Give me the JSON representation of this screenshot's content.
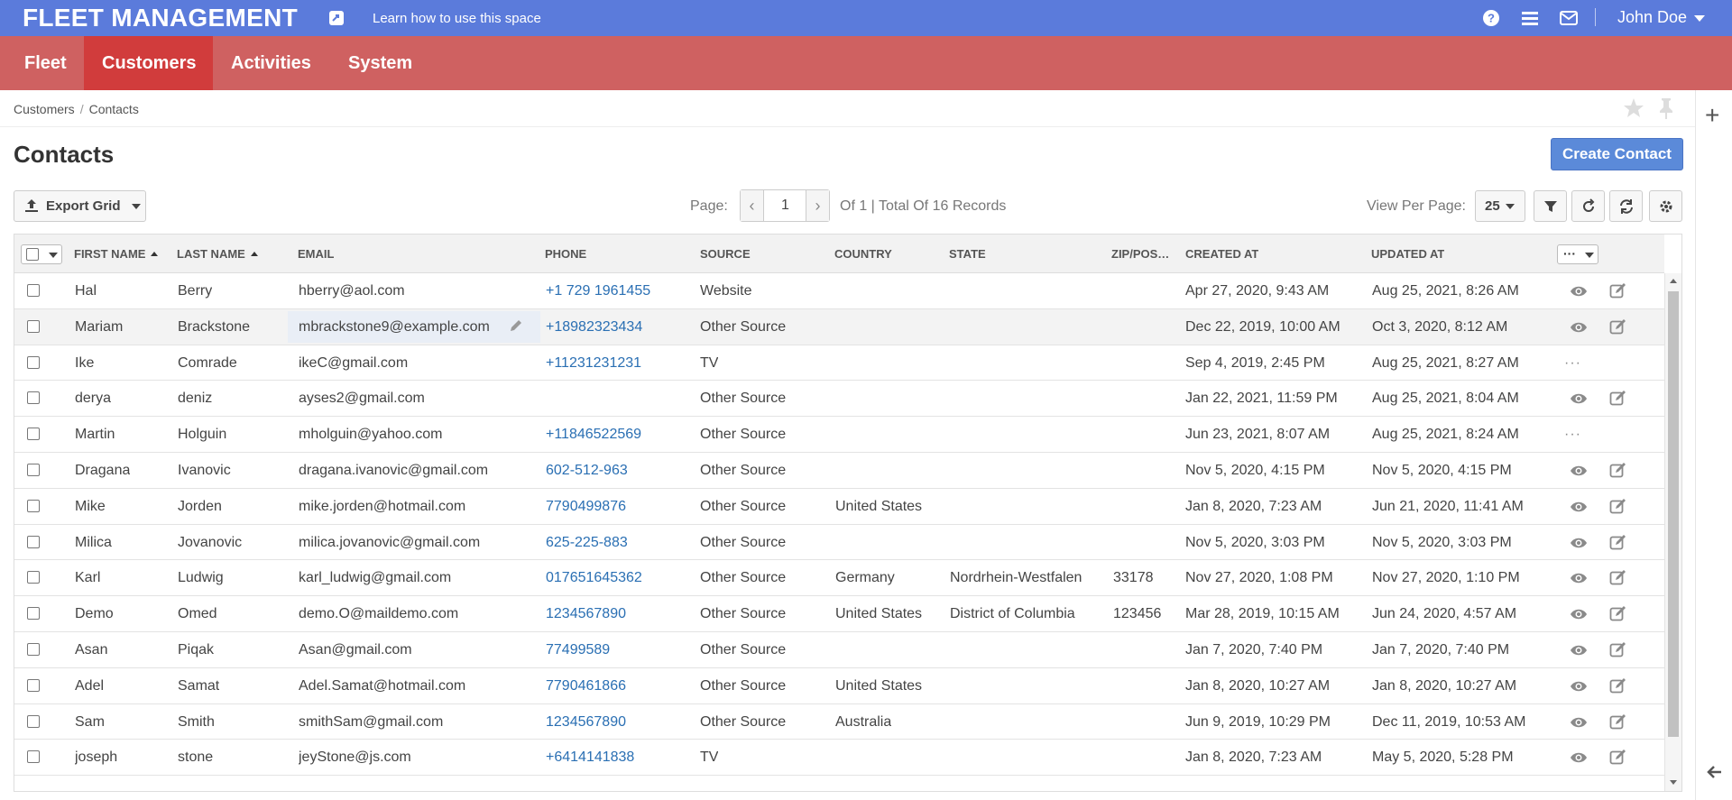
{
  "app": {
    "title": "FLEET MANAGEMENT",
    "learn_link": "Learn how to use this space",
    "user_name": "John Doe",
    "icons": [
      "help-icon",
      "list-icon",
      "mail-icon"
    ]
  },
  "nav": {
    "items": [
      {
        "label": "Fleet",
        "active": false
      },
      {
        "label": "Customers",
        "active": true
      },
      {
        "label": "Activities",
        "active": false
      },
      {
        "label": "System",
        "active": false
      }
    ]
  },
  "breadcrumb": {
    "parent": "Customers",
    "separator": "/",
    "current": "Contacts"
  },
  "page": {
    "title": "Contacts",
    "create_button": "Create Contact"
  },
  "toolbar": {
    "export_label": "Export Grid",
    "page_label": "Page:",
    "page_value": "1",
    "page_total": "Of 1 | Total Of 16 Records",
    "view_per_page_label": "View Per Page:",
    "view_per_page_value": "25"
  },
  "grid": {
    "columns": [
      "First Name",
      "Last Name",
      "Email",
      "Phone",
      "Source",
      "Country",
      "State",
      "Zip/Pos…",
      "Created At",
      "Updated At"
    ],
    "rows": [
      {
        "first": "Hal",
        "last": "Berry",
        "email": "hberry@aol.com",
        "phone": "+1 729 1961455",
        "source": "Website",
        "country": "",
        "state": "",
        "zip": "",
        "created": "Apr 27, 2020, 9:43 AM",
        "updated": "Aug 25, 2021, 8:26 AM",
        "actions": "icons"
      },
      {
        "first": "Mariam",
        "last": "Brackstone",
        "email": "mbrackstone9@example.com",
        "phone": "+18982323434",
        "source": "Other Source",
        "country": "",
        "state": "",
        "zip": "",
        "created": "Dec 22, 2019, 10:00 AM",
        "updated": "Oct 3, 2020, 8:12 AM",
        "actions": "icons"
      },
      {
        "first": "Ike",
        "last": "Comrade",
        "email": "ikeC@gmail.com",
        "phone": "+11231231231",
        "source": "TV",
        "country": "",
        "state": "",
        "zip": "",
        "created": "Sep 4, 2019, 2:45 PM",
        "updated": "Aug 25, 2021, 8:27 AM",
        "actions": "more"
      },
      {
        "first": "derya",
        "last": "deniz",
        "email": "ayses2@gmail.com",
        "phone": "",
        "source": "Other Source",
        "country": "",
        "state": "",
        "zip": "",
        "created": "Jan 22, 2021, 11:59 PM",
        "updated": "Aug 25, 2021, 8:04 AM",
        "actions": "icons"
      },
      {
        "first": "Martin",
        "last": "Holguin",
        "email": "mholguin@yahoo.com",
        "phone": "+11846522569",
        "source": "Other Source",
        "country": "",
        "state": "",
        "zip": "",
        "created": "Jun 23, 2021, 8:07 AM",
        "updated": "Aug 25, 2021, 8:24 AM",
        "actions": "more"
      },
      {
        "first": "Dragana",
        "last": "Ivanovic",
        "email": "dragana.ivanovic@gmail.com",
        "phone": "602-512-963",
        "source": "Other Source",
        "country": "",
        "state": "",
        "zip": "",
        "created": "Nov 5, 2020, 4:15 PM",
        "updated": "Nov 5, 2020, 4:15 PM",
        "actions": "icons"
      },
      {
        "first": "Mike",
        "last": "Jorden",
        "email": "mike.jorden@hotmail.com",
        "phone": "7790499876",
        "source": "Other Source",
        "country": "United States",
        "state": "",
        "zip": "",
        "created": "Jan 8, 2020, 7:23 AM",
        "updated": "Jun 21, 2020, 11:41 AM",
        "actions": "icons"
      },
      {
        "first": "Milica",
        "last": "Jovanovic",
        "email": "milica.jovanovic@gmail.com",
        "phone": "625-225-883",
        "source": "Other Source",
        "country": "",
        "state": "",
        "zip": "",
        "created": "Nov 5, 2020, 3:03 PM",
        "updated": "Nov 5, 2020, 3:03 PM",
        "actions": "icons"
      },
      {
        "first": "Karl",
        "last": "Ludwig",
        "email": "karl_ludwig@gmail.com",
        "phone": "017651645362",
        "source": "Other Source",
        "country": "Germany",
        "state": "Nordrhein-Westfalen",
        "zip": "33178",
        "created": "Nov 27, 2020, 1:08 PM",
        "updated": "Nov 27, 2020, 1:10 PM",
        "actions": "icons"
      },
      {
        "first": "Demo",
        "last": "Omed",
        "email": "demo.O@maildemo.com",
        "phone": "1234567890",
        "source": "Other Source",
        "country": "United States",
        "state": "District of Columbia",
        "zip": "123456",
        "created": "Mar 28, 2019, 10:15 AM",
        "updated": "Jun 24, 2020, 4:57 AM",
        "actions": "icons"
      },
      {
        "first": "Asan",
        "last": "Piqak",
        "email": "Asan@gmail.com",
        "phone": "77499589",
        "source": "Other Source",
        "country": "",
        "state": "",
        "zip": "",
        "created": "Jan 7, 2020, 7:40 PM",
        "updated": "Jan 7, 2020, 7:40 PM",
        "actions": "icons"
      },
      {
        "first": "Adel",
        "last": "Samat",
        "email": "Adel.Samat@hotmail.com",
        "phone": "7790461866",
        "source": "Other Source",
        "country": "United States",
        "state": "",
        "zip": "",
        "created": "Jan 8, 2020, 10:27 AM",
        "updated": "Jan 8, 2020, 10:27 AM",
        "actions": "icons"
      },
      {
        "first": "Sam",
        "last": "Smith",
        "email": "smithSam@gmail.com",
        "phone": "1234567890",
        "source": "Other Source",
        "country": "Australia",
        "state": "",
        "zip": "",
        "created": "Jun 9, 2019, 10:29 PM",
        "updated": "Dec 11, 2019, 10:53 AM",
        "actions": "icons"
      },
      {
        "first": "joseph",
        "last": "stone",
        "email": "jeyStone@js.com",
        "phone": "+6414141838",
        "source": "TV",
        "country": "",
        "state": "",
        "zip": "",
        "created": "Jan 8, 2020, 7:23 AM",
        "updated": "May 5, 2020, 5:28 PM",
        "actions": "icons"
      }
    ]
  },
  "colors": {
    "topbar": "#5b7bdb",
    "navbar": "#cf6161",
    "nav_active": "#d13c3c",
    "link": "#2a6fb3",
    "primary_button": "#5b8ad9"
  }
}
